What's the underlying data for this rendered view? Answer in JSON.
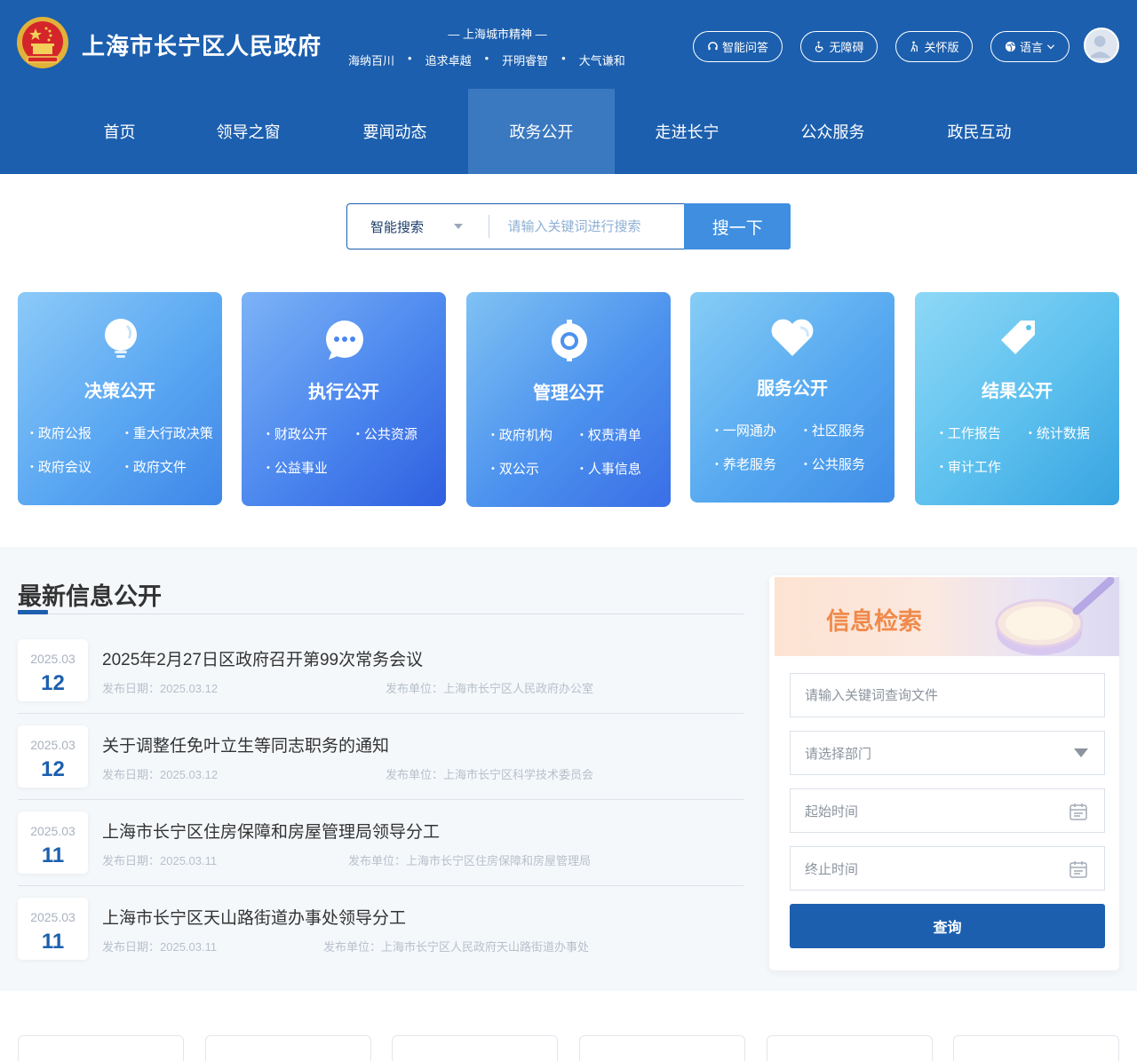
{
  "header": {
    "site_title": "上海市长宁区人民政府",
    "spirit_title": "— 上海城市精神 —",
    "spirit_values": [
      "海纳百川",
      "追求卓越",
      "开明睿智",
      "大气谦和"
    ],
    "buttons": {
      "ai_qa": "智能问答",
      "accessibility": "无障碍",
      "elder_mode": "关怀版",
      "language": "语言"
    }
  },
  "nav": {
    "items": [
      "首页",
      "领导之窗",
      "要闻动态",
      "政务公开",
      "走进长宁",
      "公众服务",
      "政民互动"
    ],
    "active": "政务公开"
  },
  "search": {
    "type_label": "智能搜索",
    "placeholder": "请输入关键词进行搜索",
    "button": "搜一下"
  },
  "cards": [
    {
      "title": "决策公开",
      "icon": "lightbulb-icon",
      "links": [
        "政府公报",
        "重大行政决策",
        "政府会议",
        "政府文件"
      ]
    },
    {
      "title": "执行公开",
      "icon": "chat-bubble-icon",
      "links": [
        "财政公开",
        "公共资源",
        "公益事业"
      ]
    },
    {
      "title": "管理公开",
      "icon": "gear-icon",
      "links": [
        "政府机构",
        "权责清单",
        "双公示",
        "人事信息"
      ]
    },
    {
      "title": "服务公开",
      "icon": "heart-icon",
      "links": [
        "一网通办",
        "社区服务",
        "养老服务",
        "公共服务"
      ]
    },
    {
      "title": "结果公开",
      "icon": "tag-icon",
      "links": [
        "工作报告",
        "统计数据",
        "审计工作"
      ]
    }
  ],
  "latest": {
    "title": "最新信息公开",
    "date_label": "发布日期：",
    "unit_label": "发布单位：",
    "items": [
      {
        "ym": "2025.03",
        "day": "12",
        "title": "2025年2月27日区政府召开第99次常务会议",
        "date": "2025.03.12",
        "unit": "上海市长宁区人民政府办公室"
      },
      {
        "ym": "2025.03",
        "day": "12",
        "title": "关于调整任免叶立生等同志职务的通知",
        "date": "2025.03.12",
        "unit": "上海市长宁区科学技术委员会"
      },
      {
        "ym": "2025.03",
        "day": "11",
        "title": "上海市长宁区住房保障和房屋管理局领导分工",
        "date": "2025.03.11",
        "unit": "上海市长宁区住房保障和房屋管理局"
      },
      {
        "ym": "2025.03",
        "day": "11",
        "title": "上海市长宁区天山路街道办事处领导分工",
        "date": "2025.03.11",
        "unit": "上海市长宁区人民政府天山路街道办事处"
      }
    ]
  },
  "retrieval": {
    "title": "信息检索",
    "keyword_placeholder": "请输入关键词查询文件",
    "dept_placeholder": "请选择部门",
    "start_placeholder": "起始时间",
    "end_placeholder": "终止时间",
    "query_button": "查询"
  },
  "colors": {
    "primary": "#1c5fae",
    "nav_active": "#3a78c0",
    "search_button": "#3f8ee0",
    "retrieval_title": "#f08a4b"
  }
}
